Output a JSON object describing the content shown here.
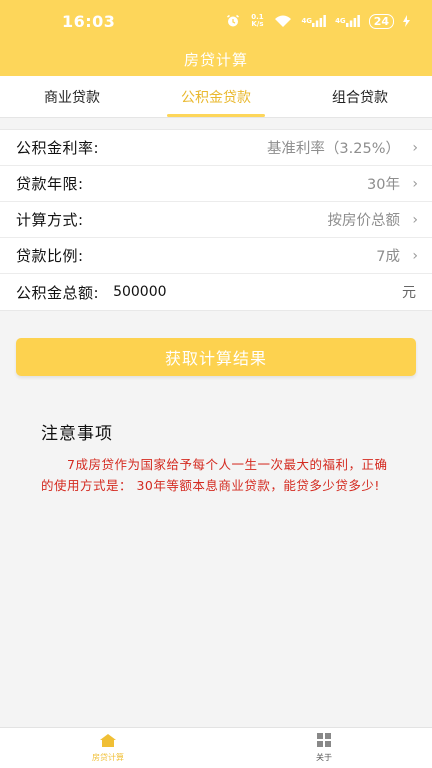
{
  "status_bar": {
    "time": "16:03",
    "net_speed": "0.1 K/s",
    "signal1": "4G",
    "signal2": "4G",
    "battery": "24"
  },
  "header": {
    "title": "房贷计算"
  },
  "tabs": [
    {
      "label": "商业贷款"
    },
    {
      "label": "公积金贷款"
    },
    {
      "label": "组合贷款"
    }
  ],
  "form": {
    "rate_label": "公积金利率:",
    "rate_value": "基准利率（3.25%）",
    "years_label": "贷款年限:",
    "years_value": "30年",
    "method_label": "计算方式:",
    "method_value": "按房价总额",
    "ratio_label": "贷款比例:",
    "ratio_value": "7成",
    "amount_label": "公积金总额:",
    "amount_value": "500000",
    "amount_unit": "元"
  },
  "submit_label": "获取计算结果",
  "notes": {
    "title": "注意事项",
    "text": "7成房贷作为国家给予每个人一生一次最大的福利，正确的使用方式是： 30年等额本息商业贷款，能贷多少贷多少!"
  },
  "bottom_nav": [
    {
      "label": "房贷计算",
      "icon": "house-icon"
    },
    {
      "label": "关于",
      "icon": "grid-icon"
    }
  ],
  "colors": {
    "accent": "#fdd65a",
    "active_tab": "#e9b82d",
    "note_text": "#d42b21"
  }
}
